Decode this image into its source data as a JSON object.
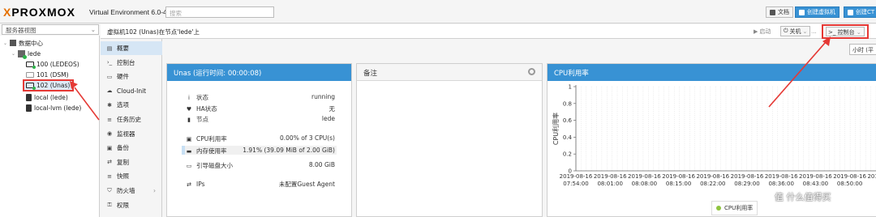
{
  "header": {
    "logo_text": "PROXMOX",
    "logo_x": "X",
    "product": "Virtual Environment 6.0-4",
    "search_placeholder": "搜索",
    "docs_label": "文档",
    "create_vm_label": "创建虚拟机",
    "create_ct_label": "创建CT"
  },
  "tree": {
    "view_label": "服务器视图",
    "datacenter": "数据中心",
    "node": "lede",
    "items": [
      {
        "label": "100 (LEDEOS)"
      },
      {
        "label": "101 (DSM)"
      },
      {
        "label": "102 (Unas)"
      },
      {
        "label": "local (lede)"
      },
      {
        "label": "local-lvm (lede)"
      }
    ]
  },
  "crumb": "虚拟机102 (Unas)在节点'lede'上",
  "toolbar": {
    "start": "启动",
    "shutdown": "关机",
    "more": "...",
    "console": "控制台"
  },
  "nav": [
    {
      "label": "概要",
      "icon": "list-icon"
    },
    {
      "label": "控制台",
      "icon": "terminal-icon"
    },
    {
      "label": "硬件",
      "icon": "monitor-icon"
    },
    {
      "label": "Cloud-Init",
      "icon": "cloud-icon"
    },
    {
      "label": "选项",
      "icon": "gear-icon"
    },
    {
      "label": "任务历史",
      "icon": "history-icon"
    },
    {
      "label": "监视器",
      "icon": "eye-icon"
    },
    {
      "label": "备份",
      "icon": "floppy-icon"
    },
    {
      "label": "复制",
      "icon": "retweet-icon"
    },
    {
      "label": "快照",
      "icon": "history-icon"
    },
    {
      "label": "防火墙",
      "icon": "shield-icon"
    },
    {
      "label": "权限",
      "icon": "unlock-icon"
    }
  ],
  "timeframe": "小时 (平",
  "status": {
    "title": "Unas (运行时间: 00:00:08)",
    "rows": [
      {
        "icon": "info-icon",
        "key": "状态",
        "value": "running"
      },
      {
        "icon": "heartbeat-icon",
        "key": "HA状态",
        "value": "无"
      },
      {
        "icon": "building-icon",
        "key": "节点",
        "value": "lede"
      },
      {
        "icon": "cpu-icon",
        "key": "CPU利用率",
        "value": "0.00% of 3 CPU(s)"
      },
      {
        "icon": "memory-icon",
        "key": "内存使用率",
        "value": "1.91% (39.09 MiB of 2.00 GiB)"
      },
      {
        "icon": "hdd-icon",
        "key": "引导磁盘大小",
        "value": "8.00 GiB"
      },
      {
        "icon": "exchange-icon",
        "key": "IPs",
        "value": "未配置Guest Agent"
      }
    ],
    "memory_fraction": 0.0191
  },
  "notes": {
    "title": "备注"
  },
  "cpu_chart": {
    "title": "CPU利用率",
    "legend": "CPU利用率"
  },
  "chart_data": {
    "type": "line",
    "title": "CPU利用率",
    "ylabel": "CPU利用率",
    "ylim": [
      0,
      1
    ],
    "yticks": [
      "0",
      "0.2",
      "0.4",
      "0.6",
      "0.8",
      "1"
    ],
    "x_dates": [
      "2019-08-16",
      "2019-08-16",
      "2019-08-16",
      "2019-08-16",
      "2019-08-16",
      "2019-08-16",
      "2019-08-16",
      "2019-08-16",
      "2019-08-16",
      "2019-08-16",
      "2019-08-16"
    ],
    "x_times": [
      "07:54:00",
      "08:01:00",
      "08:08:00",
      "08:15:00",
      "08:22:00",
      "08:29:00",
      "08:36:00",
      "08:43:00",
      "08:50:00",
      "",
      ""
    ],
    "series": [
      {
        "name": "CPU利用率",
        "values": []
      }
    ]
  },
  "watermark": "值 什么值得买"
}
